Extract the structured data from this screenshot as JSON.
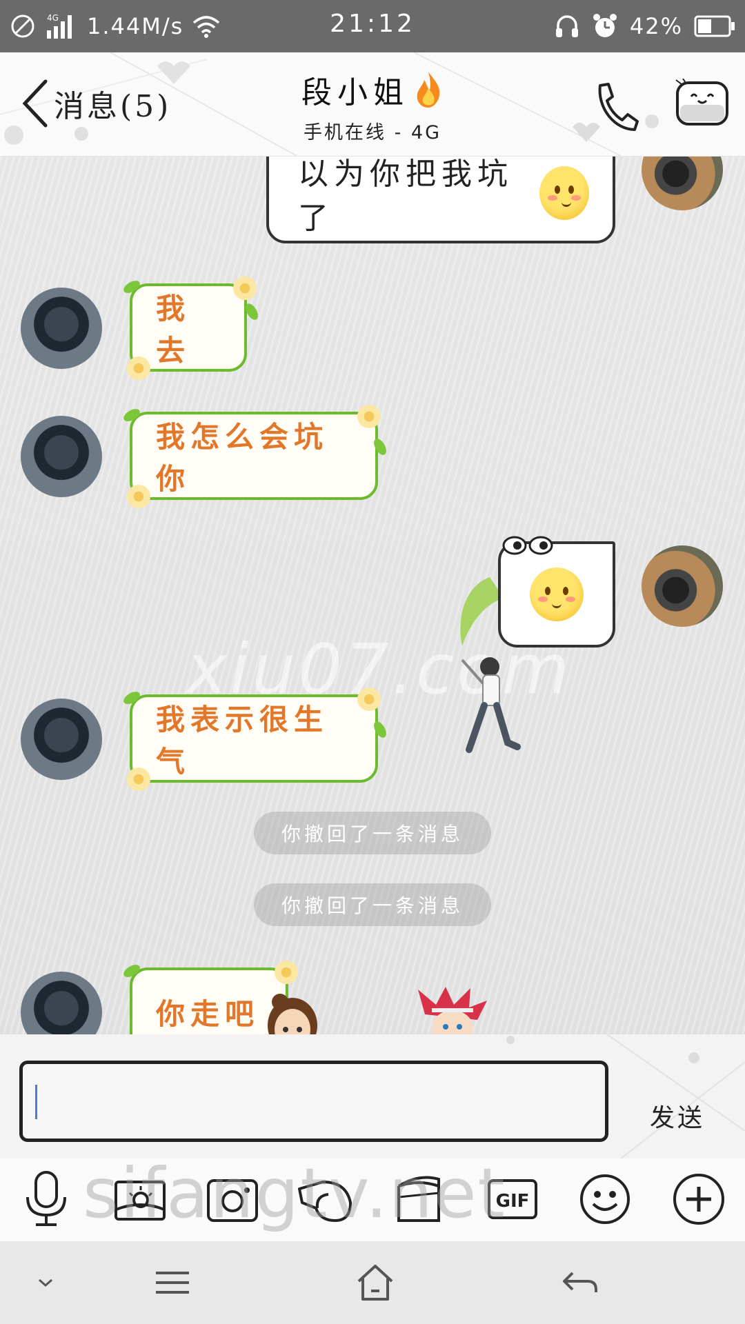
{
  "status_bar": {
    "network": "4G",
    "speed": "1.44M/s",
    "time": "21:12",
    "battery": "42%"
  },
  "header": {
    "back_label": "消息(5)",
    "title": "段小姐",
    "subtitle": "手机在线 - 4G"
  },
  "messages": [
    {
      "side": "me",
      "text": "以为你把我坑了",
      "emoji": "blush-emoji"
    },
    {
      "side": "friend",
      "text": "我去"
    },
    {
      "side": "friend",
      "text": "我怎么会坑你"
    },
    {
      "side": "me",
      "text": "",
      "emoji": "blush-emoji"
    },
    {
      "side": "friend",
      "text": "我表示很生气"
    },
    {
      "side": "system",
      "text": "你撤回了一条消息"
    },
    {
      "side": "system",
      "text": "你撤回了一条消息"
    },
    {
      "side": "friend",
      "text": "你走吧"
    }
  ],
  "watermarks": [
    "xiu07.com",
    "sifangtv.net"
  ],
  "input": {
    "value": "",
    "send_label": "发送"
  },
  "toolbar": {
    "items": [
      "mic-icon",
      "image-icon",
      "camera-icon",
      "shake-icon",
      "wallet-icon",
      "GIF",
      "emoji-icon",
      "plus-icon"
    ],
    "gif_label": "GIF"
  },
  "navbar": {
    "items": [
      "chevron-down-icon",
      "menu-icon",
      "home-icon",
      "back-arrow-icon"
    ]
  },
  "colors": {
    "bubble_green_border": "#6cbb2c",
    "bubble_green_text": "#e2772a",
    "status_bar": "#6a6a6a"
  }
}
